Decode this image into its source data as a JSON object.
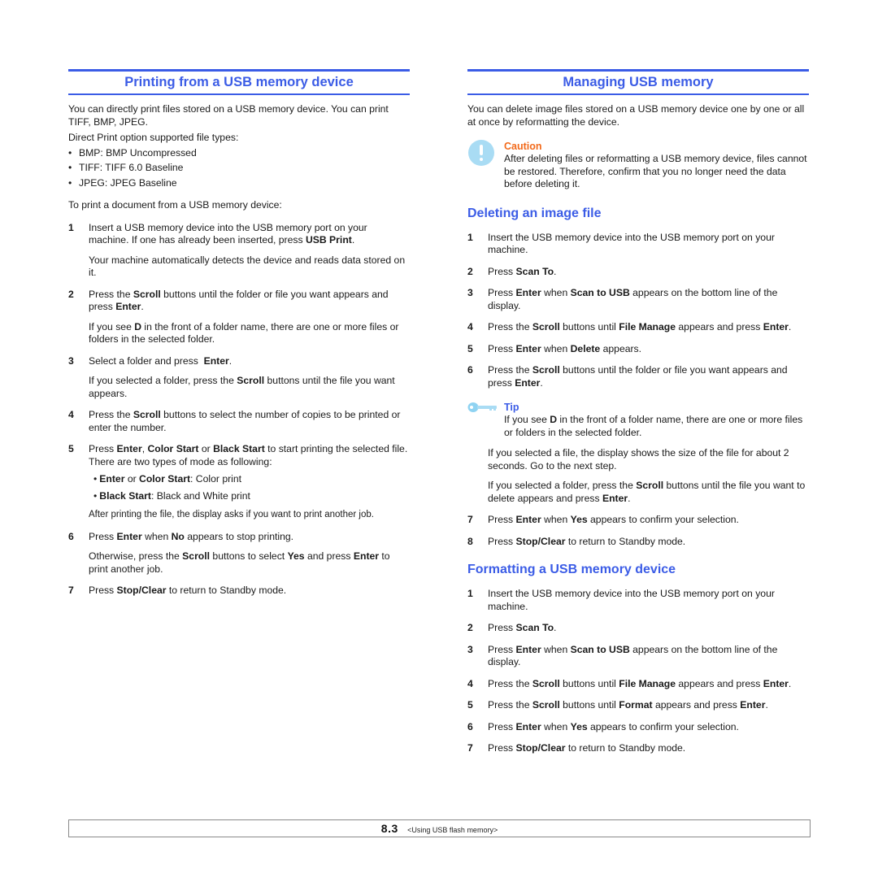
{
  "left": {
    "heading": "Printing from a USB memory device",
    "intro": "You can directly print files stored on a USB memory device. You can print TIFF, BMP, JPEG.",
    "filetypes_label": "Direct Print option supported file types:",
    "filetypes": [
      "BMP: BMP Uncompressed",
      "TIFF: TIFF 6.0 Baseline",
      "JPEG: JPEG Baseline"
    ],
    "lead": "To print a document from a USB memory device:",
    "steps": [
      {
        "num": "1",
        "t1": "Insert a USB memory device into the USB memory port on your machine. If one has already been inserted, press ",
        "b1": "USB Print",
        "t2": ".",
        "sub": "Your machine automatically detects the device and reads data stored on it."
      },
      {
        "num": "2",
        "t1": "Press the ",
        "b1": "Scroll",
        "t2": " buttons until the folder or file you want appears and press ",
        "b2": "Enter",
        "t3": ".",
        "sub_t1": "If you see ",
        "sub_b1": "D",
        "sub_t2": " in the front of a folder name, there are one or more files or folders in the selected folder."
      },
      {
        "num": "3",
        "t1": "Select a folder and press  ",
        "b1": "Enter",
        "t2": ".",
        "sub_t1": "If you selected a folder, press the ",
        "sub_b1": "Scroll",
        "sub_t2": " buttons until the file you want appears."
      },
      {
        "num": "4",
        "t1": "Press the ",
        "b1": "Scroll",
        "t2": " buttons to select the number of copies to be printed or enter the number."
      },
      {
        "num": "5",
        "t1": "Press ",
        "b1": "Enter",
        "t2": ", ",
        "b2": "Color Start",
        "t3": " or ",
        "b3": "Black Start",
        "t4": " to start printing the selected file.",
        "line2": "There are two types of mode as following:",
        "modes": [
          {
            "b1": "Enter",
            "t1": " or ",
            "b2": "Color Start",
            "t2": ": Color print"
          },
          {
            "b1": "Black Start",
            "t1": ": Black and White print"
          }
        ],
        "after": "After printing the file, the display asks if you want to print another job."
      },
      {
        "num": "6",
        "t1": "Press ",
        "b1": "Enter",
        "t2": " when ",
        "b2": "No",
        "t3": " appears to stop printing.",
        "sub_t1": "Otherwise, press the ",
        "sub_b1": "Scroll",
        "sub_t2": " buttons to select ",
        "sub_b2": "Yes",
        "sub_t3": " and press ",
        "sub_b3": "Enter",
        "sub_t4": " to print another job."
      },
      {
        "num": "7",
        "t1": "Press ",
        "b1": "Stop/Clear",
        "t2": " to return to Standby mode."
      }
    ]
  },
  "right": {
    "heading": "Managing USB memory",
    "intro": "You can delete image files stored on a USB memory device one by one or all at once by reformatting the device.",
    "caution": {
      "icon": "exclamation-icon",
      "title": "Caution",
      "text": "After deleting files or reformatting a USB memory device, files cannot be restored. Therefore, confirm that you no longer need the data before deleting it."
    },
    "delete": {
      "heading": "Deleting an image file",
      "steps": [
        {
          "num": "1",
          "t1": "Insert the USB memory device into the USB memory port on your machine."
        },
        {
          "num": "2",
          "t1": "Press ",
          "b1": "Scan To",
          "t2": "."
        },
        {
          "num": "3",
          "t1": "Press ",
          "b1": "Enter",
          "t2": " when ",
          "b2": "Scan to USB",
          "t3": " appears on the bottom line of the display."
        },
        {
          "num": "4",
          "t1": "Press the ",
          "b1": "Scroll",
          "t2": " buttons until ",
          "b2": "File Manage",
          "t3": " appears and press ",
          "b3": "Enter",
          "t4": "."
        },
        {
          "num": "5",
          "t1": "Press ",
          "b1": "Enter",
          "t2": " when ",
          "b2": "Delete",
          "t3": " appears."
        },
        {
          "num": "6",
          "t1": "Press the ",
          "b1": "Scroll",
          "t2": " buttons until the folder or file you want appears and press ",
          "b2": "Enter",
          "t3": ".",
          "tip": {
            "icon": "key-icon",
            "title": "Tip",
            "t1": "If you see ",
            "b1": "D",
            "t2": " in the front of a folder name, there are one or more files or folders in the selected folder."
          },
          "sub1": "If you selected a file, the display shows the size of the file for about 2 seconds. Go to the next step.",
          "sub2_t1": "If you selected a folder, press the ",
          "sub2_b1": "Scroll",
          "sub2_t2": " buttons until the file you want to delete appears and press ",
          "sub2_b2": "Enter",
          "sub2_t3": "."
        },
        {
          "num": "7",
          "t1": "Press ",
          "b1": "Enter",
          "t2": " when ",
          "b2": "Yes",
          "t3": " appears to confirm your selection."
        },
        {
          "num": "8",
          "t1": "Press ",
          "b1": "Stop/Clear",
          "t2": " to return to Standby mode."
        }
      ]
    },
    "format": {
      "heading": "Formatting a USB memory device",
      "steps": [
        {
          "num": "1",
          "t1": "Insert the USB memory device into the USB memory port on your machine."
        },
        {
          "num": "2",
          "t1": "Press ",
          "b1": "Scan To",
          "t2": "."
        },
        {
          "num": "3",
          "t1": "Press ",
          "b1": "Enter",
          "t2": " when ",
          "b2": "Scan to USB",
          "t3": " appears on the bottom line of the display."
        },
        {
          "num": "4",
          "t1": "Press the ",
          "b1": "Scroll",
          "t2": " buttons until ",
          "b2": "File Manage",
          "t3": " appears and press ",
          "b3": "Enter",
          "t4": "."
        },
        {
          "num": "5",
          "t1": "Press the ",
          "b1": "Scroll",
          "t2": " buttons until ",
          "b2": "Format",
          "t3": " appears and press ",
          "b3": "Enter",
          "t4": "."
        },
        {
          "num": "6",
          "t1": "Press ",
          "b1": "Enter",
          "t2": " when ",
          "b2": "Yes",
          "t3": " appears to confirm your selection."
        },
        {
          "num": "7",
          "t1": "Press ",
          "b1": "Stop/Clear",
          "t2": " to return to Standby mode."
        }
      ]
    }
  },
  "footer": {
    "page_number": "8.3",
    "chapter": "<Using USB flash memory>"
  },
  "colors": {
    "heading_blue": "#3b5ce6",
    "caution_orange": "#f26a1b",
    "icon_light_blue": "#a9dcf4"
  }
}
